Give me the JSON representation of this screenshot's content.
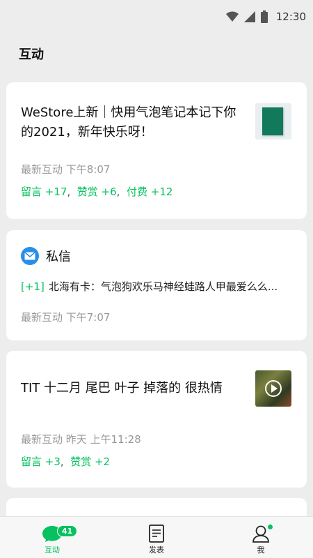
{
  "status_bar": {
    "time": "12:30"
  },
  "page": {
    "title": "互动"
  },
  "cards": [
    {
      "title": "WeStore上新｜快用气泡笔记本记下你的2021，新年快乐呀！",
      "meta": "最新互动 下午8:07",
      "stats": {
        "comments": "留言 +17",
        "likes": "赞赏 +6",
        "paid": "付费 +12"
      },
      "thumbnail": "notebook-thumbnail"
    },
    {
      "title": "私信",
      "badge": "[+1]",
      "message": "北海有卡：气泡狗欢乐马神经蛙路人甲最爱么么...",
      "meta": "最新互动  下午7:07",
      "icon": "mail-icon"
    },
    {
      "title": "TIT 十二月 尾巴 叶子 掉落的 很热情",
      "meta": "最新互动 昨天 上午11:28",
      "stats": {
        "comments": "留言 +3",
        "likes": "赞赏 +2"
      },
      "thumbnail": "video-thumbnail"
    }
  ],
  "tabbar": {
    "tabs": [
      {
        "label": "互动",
        "badge": "41",
        "icon": "chat-bubble-icon",
        "active": true
      },
      {
        "label": "发表",
        "icon": "document-icon"
      },
      {
        "label": "我",
        "icon": "person-icon",
        "dot": true
      }
    ]
  },
  "colors": {
    "accent": "#07c160",
    "background": "#ededed",
    "card": "#ffffff",
    "meta_text": "#999999"
  }
}
